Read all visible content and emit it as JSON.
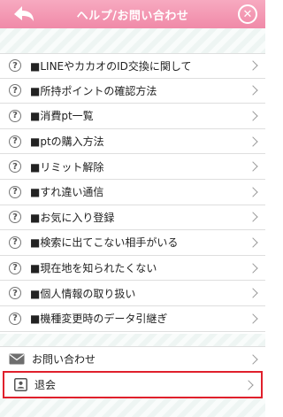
{
  "header": {
    "title": "ヘルプ/お問い合わせ",
    "back_icon": "back-arrow-icon",
    "close_icon": "close-circle-icon",
    "close_glyph": "✕",
    "color": "#f08aa8"
  },
  "faq": {
    "icon_glyph": "?",
    "items": [
      {
        "label": "■LINEやカカオのID交換に関して"
      },
      {
        "label": "■所持ポイントの確認方法"
      },
      {
        "label": "■消費pt一覧"
      },
      {
        "label": "■ptの購入方法"
      },
      {
        "label": "■リミット解除"
      },
      {
        "label": "■すれ違い通信"
      },
      {
        "label": "■お気に入り登録"
      },
      {
        "label": "■検索に出てこない相手がいる"
      },
      {
        "label": "■現在地を知られたくない"
      },
      {
        "label": "■個人情報の取り扱い"
      },
      {
        "label": "■機種変更時のデータ引継ぎ"
      }
    ]
  },
  "contact": {
    "label": "お問い合わせ",
    "icon": "mail-icon"
  },
  "withdraw": {
    "label": "退会",
    "icon": "member-card-icon",
    "highlight_color": "#e0202c"
  }
}
